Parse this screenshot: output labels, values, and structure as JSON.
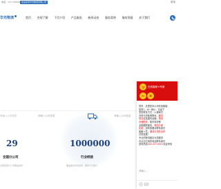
{
  "topbar": {
    "left_text": "电话：137-7000000",
    "tag_text": "欢迎来到华光物流有限公司",
    "right_text": "登录"
  },
  "header": {
    "logo_text": "华光物流",
    "nav": [
      "首页",
      "合规了解",
      "下页介绍",
      "产品服务",
      "新闻动态",
      "服务案例",
      "服务答疑",
      "关于我们"
    ]
  },
  "stats": {
    "top_labels": [
      "请输入公司信息",
      "请输入公司信息",
      "请输入公司信息"
    ],
    "items": [
      {
        "value": "29",
        "label": "全国分公司",
        "desc": "全国范围分公司覆盖城市"
      },
      {
        "value": "1000000",
        "label": "行业经验",
        "desc": "覆盖路线专线运营，服务千万客户"
      }
    ]
  },
  "chat": {
    "title": "在线客服·0号客",
    "messages": [
      [
        {
          "t": "您好，这里是本公司在线客服，"
        }
      ],
      [
        {
          "t": "如需1—对一报价，请留下"
        }
      ],
      [
        {
          "t": "您的联系方式，以便我们"
        }
      ],
      [
        {
          "t": "尽快与您取得联系。"
        },
        {
          "t": "服务",
          "red": true
        }
      ],
      [
        {
          "t": "项目",
          "red": true
        },
        {
          "t": "包括国内运输，"
        },
        {
          "t": "物流",
          "red": true
        }
      ],
      [
        {
          "t": "仓储配送",
          "red": true
        },
        {
          "t": "，整车零担等"
        }
      ],
      [
        {
          "t": "全程跟踪服务，"
        },
        {
          "t": "物流方案",
          "red": true
        }
      ],
      [
        {
          "t": "定制，",
          "red": true
        },
        {
          "t": "如有需要请联系我们"
        }
      ],
      [
        {
          "t": "客服人员。"
        },
        {
          "t": "期待与您的合作",
          "red": true
        }
      ],
      [
        {
          "t": "共同发展！"
        }
      ],
      [
        {
          "t": "专业的物流团队为您服务"
        }
      ],
      [
        {
          "t": "可点击右侧的电话联系我们"
        }
      ],
      [
        {
          "t": "咨询热线"
        },
        {
          "t": "400-027-0001",
          "red": true
        },
        {
          "t": "欢迎来电"
        }
      ]
    ],
    "input_placeholder": "请输入..."
  },
  "colors": {
    "brand": "#2a6cb5",
    "number": "#1d3f7a",
    "chat_header": "#d80d0d",
    "accent": "#f5c518"
  }
}
